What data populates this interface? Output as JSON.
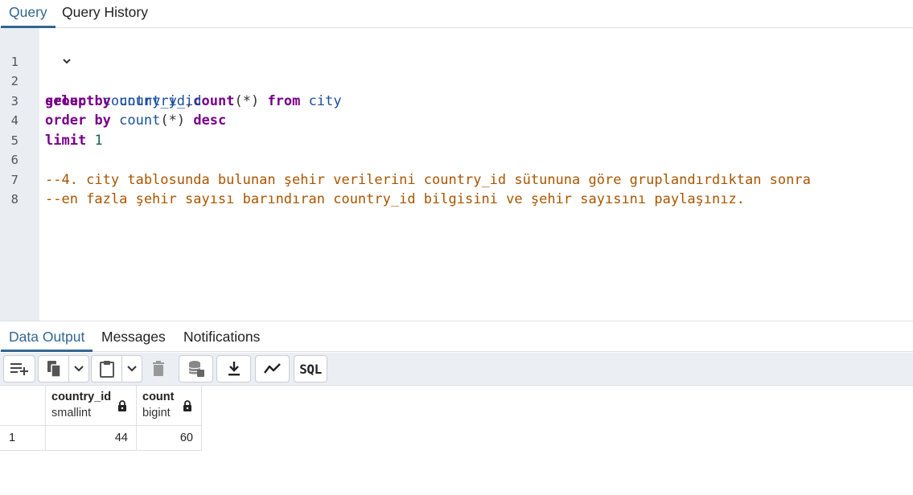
{
  "query_tabs": [
    {
      "label": "Query",
      "active": true
    },
    {
      "label": "Query History",
      "active": false
    }
  ],
  "editor": {
    "line_numbers": [
      "1",
      "2",
      "3",
      "4",
      "5",
      "6",
      "7",
      "8"
    ],
    "lines": {
      "l1": {
        "kw1": "select",
        "id1": "country_id",
        "p1": ",",
        "kw2": "count",
        "p2": "(*)",
        "kw3": "from",
        "id2": "city"
      },
      "l2": {
        "kw1": "group",
        "kw2": "by",
        "id1": "country_id"
      },
      "l3": {
        "kw1": "order",
        "kw2": "by",
        "id1": "count",
        "p1": "(*)",
        "kw3": "desc"
      },
      "l4": {
        "kw1": "limit",
        "n1": "1"
      },
      "l6": "--4. city tablosunda bulunan şehir verilerini country_id sütununa göre gruplandırdıktan sonra",
      "l7": "--en fazla şehir sayısı barındıran country_id bilgisini ve şehir sayısını paylaşınız."
    }
  },
  "output_tabs": [
    {
      "label": "Data Output",
      "active": true
    },
    {
      "label": "Messages",
      "active": false
    },
    {
      "label": "Notifications",
      "active": false
    }
  ],
  "toolbar": {
    "add_row_icon": "add-row-icon",
    "copy_icon": "copy-icon",
    "paste_icon": "paste-icon",
    "delete_icon": "delete-icon",
    "save_data_icon": "save-data-icon",
    "download_icon": "download-icon",
    "graph_icon": "graph-icon",
    "sql_label": "SQL"
  },
  "grid": {
    "columns": [
      {
        "name": "country_id",
        "type": "smallint"
      },
      {
        "name": "count",
        "type": "bigint"
      }
    ],
    "rows": [
      {
        "num": "1",
        "cells": [
          "44",
          "60"
        ]
      }
    ]
  },
  "colors": {
    "accent": "#326690",
    "keyword": "#770088",
    "identifier": "#1a4fa0",
    "number": "#116644",
    "comment": "#aa5500"
  }
}
